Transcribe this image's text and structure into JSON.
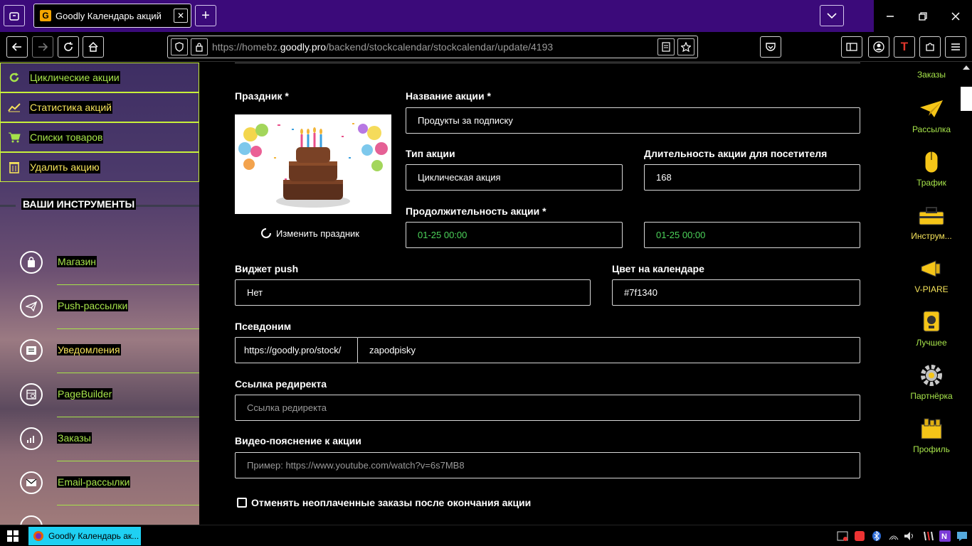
{
  "browser": {
    "tab_title": "Goodly Календарь акций",
    "tab_close": "✕",
    "new_tab": "+",
    "url_prefix": "https://homebz.",
    "url_domain": "goodly.pro",
    "url_path": "/backend/stockcalendar/stockcalendar/update/4193"
  },
  "sidebar": {
    "actions": [
      {
        "label": "Циклические акции",
        "icon": "refresh-icon",
        "color": "#a6e34a"
      },
      {
        "label": "Статистика акций",
        "icon": "chart-line-icon",
        "color": "#f5e35a"
      },
      {
        "label": "Списки товаров",
        "icon": "cart-icon",
        "color": "#a6e34a"
      },
      {
        "label": "Удалить акцию",
        "icon": "trash-icon",
        "color": "#f5e35a"
      }
    ],
    "tools_heading": "ВАШИ ИНСТРУМЕНТЫ",
    "tools": [
      {
        "label": "Магазин",
        "icon": "bag-icon",
        "color": "#a6e34a"
      },
      {
        "label": "Push-рассылки",
        "icon": "send-icon",
        "color": "#a6e34a"
      },
      {
        "label": "Уведомления",
        "icon": "notification-icon",
        "color": "#f5e35a"
      },
      {
        "label": "PageBuilder",
        "icon": "builder-icon",
        "color": "#a6e34a"
      },
      {
        "label": "Заказы",
        "icon": "orders-icon",
        "color": "#a6e34a"
      },
      {
        "label": "Email-рассылки",
        "icon": "mail-icon",
        "color": "#a6e34a"
      }
    ]
  },
  "form": {
    "holiday_label": "Праздник *",
    "change_holiday": "Изменить праздник",
    "name_label": "Название акции  *",
    "name_value": "Продукты за подписку",
    "type_label": "Тип акции",
    "type_value": "Циклическая акция",
    "duration_visitor_label": "Длительность акции для посетителя",
    "duration_visitor_value": "168",
    "period_label": "Продолжительность акции *",
    "period_start": "01-25 00:00",
    "period_end": "01-25 00:00",
    "widget_label": "Виджет push",
    "widget_value": "Нет",
    "color_label": "Цвет на календаре",
    "color_value": "#7f1340",
    "alias_label": "Псевдоним",
    "alias_prefix": "https://goodly.pro/stock/",
    "alias_value": "zapodpisky",
    "redirect_label": "Ссылка редиректа",
    "redirect_placeholder": "Ссылка редиректа",
    "video_label": "Видео-пояснение к акции",
    "video_placeholder": "Пример: https://www.youtube.com/watch?v=6s7MB8",
    "cancel_checkbox_label": "Отменять неоплаченные заказы после окончания акции"
  },
  "right_panel": [
    {
      "label": "Заказы",
      "color": "#a6e34a",
      "icon": "orders-icon"
    },
    {
      "label": "Рассылка",
      "color": "#a6e34a",
      "icon": "paper-plane-icon"
    },
    {
      "label": "Трафик",
      "color": "#a6e34a",
      "icon": "mouse-icon"
    },
    {
      "label": "Инструм...",
      "color": "#f5e35a",
      "icon": "toolbox-icon"
    },
    {
      "label": "V-PIARE",
      "color": "#f5e35a",
      "icon": "megaphone-icon"
    },
    {
      "label": "Лучшее",
      "color": "#a6e34a",
      "icon": "trophy-icon"
    },
    {
      "label": "Партнёрка",
      "color": "#a6e34a",
      "icon": "gear-icon"
    },
    {
      "label": "Профиль",
      "color": "#a6e34a",
      "icon": "profile-icon"
    }
  ],
  "taskbar": {
    "app_title": "Goodly Календарь ак..."
  },
  "colors": {
    "green_accent": "#a6e34a",
    "yellow_accent": "#f5e35a",
    "titlebar": "#3b0a7a",
    "date_green": "#4cd35a"
  }
}
